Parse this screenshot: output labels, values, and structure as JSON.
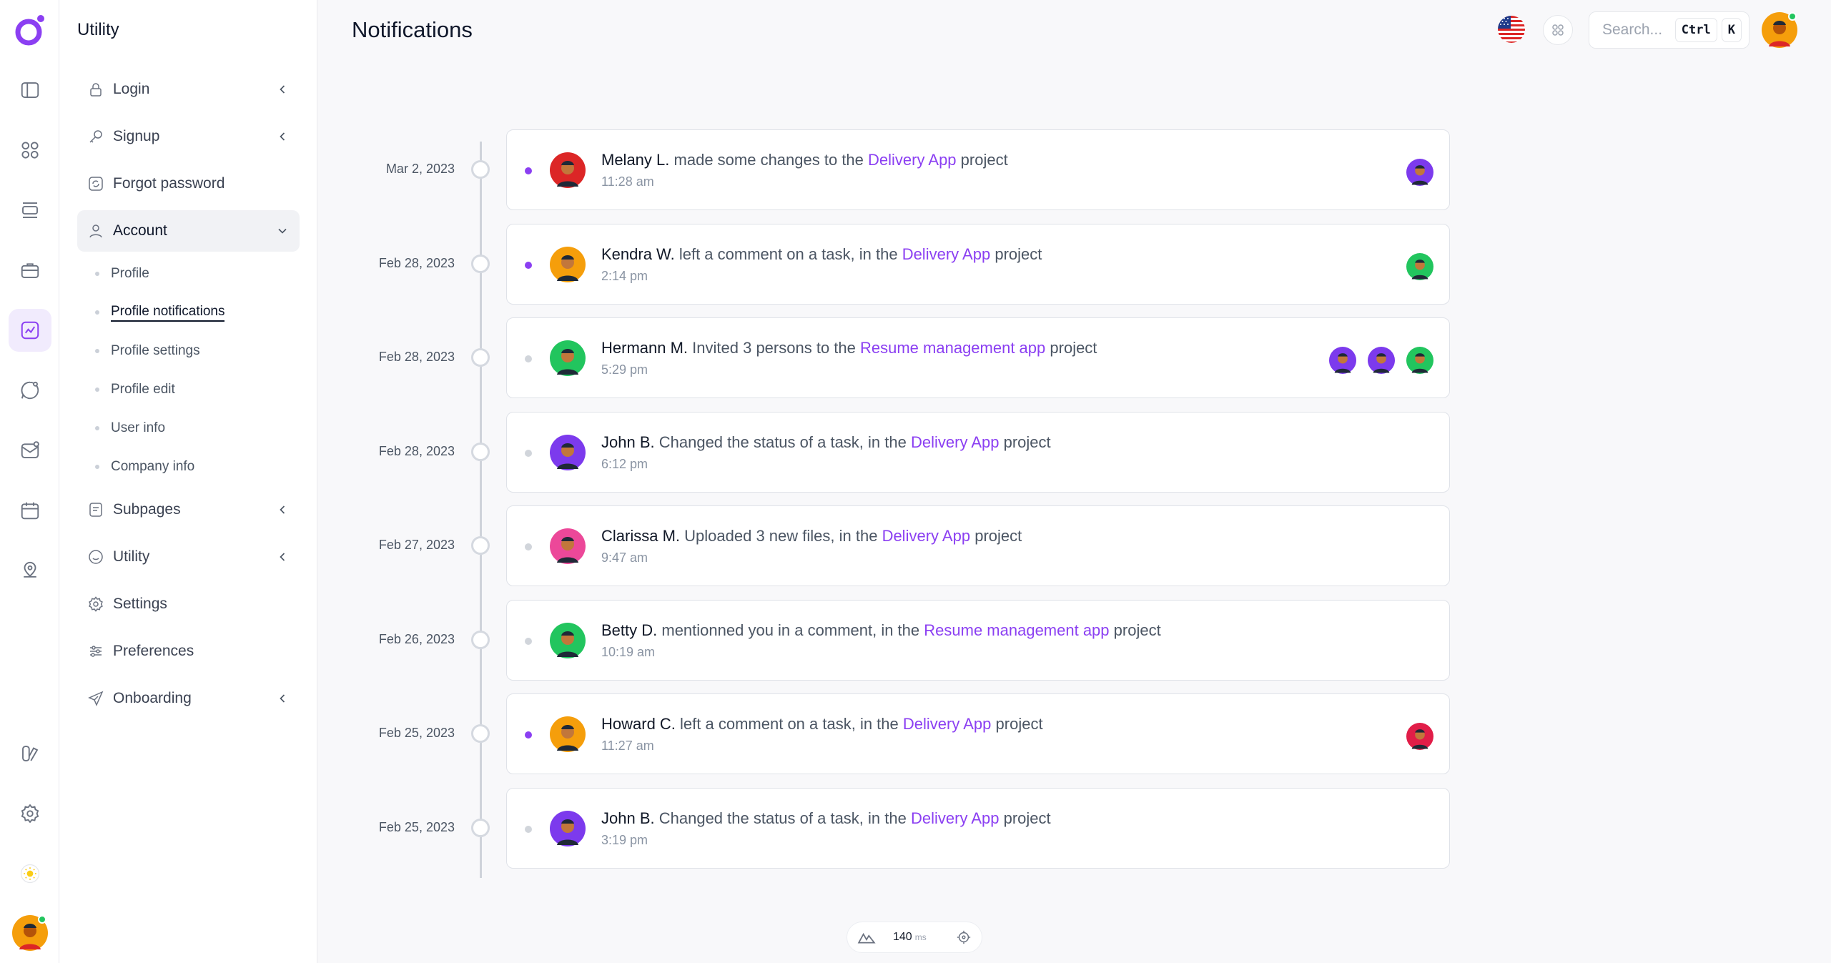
{
  "menu": {
    "title": "Utility",
    "items": [
      {
        "label": "Login"
      },
      {
        "label": "Signup"
      },
      {
        "label": "Forgot password"
      },
      {
        "label": "Account"
      },
      {
        "label": "Subpages"
      },
      {
        "label": "Utility"
      },
      {
        "label": "Settings"
      },
      {
        "label": "Preferences"
      },
      {
        "label": "Onboarding"
      }
    ],
    "account_sub": [
      {
        "label": "Profile"
      },
      {
        "label": "Profile notifications"
      },
      {
        "label": "Profile settings"
      },
      {
        "label": "Profile edit"
      },
      {
        "label": "User info"
      },
      {
        "label": "Company info"
      }
    ]
  },
  "header": {
    "title": "Notifications",
    "search_placeholder": "Search...",
    "kbd_ctrl": "Ctrl",
    "kbd_k": "K"
  },
  "colors": {
    "accent": "#8b3ff2",
    "unread": "#8b3ff2",
    "read": "#d1d5db"
  },
  "notifications": [
    {
      "date": "Mar 2, 2023",
      "name": "Melany L.",
      "text": "made some changes to the",
      "link": "Delivery App",
      "suffix": "project",
      "time": "11:28 am",
      "unread": true
    },
    {
      "date": "Feb 28, 2023",
      "name": "Kendra W.",
      "text": "left a comment on a task, in the",
      "link": "Delivery App",
      "suffix": "project",
      "time": "2:14 pm",
      "unread": true
    },
    {
      "date": "Feb 28, 2023",
      "name": "Hermann M.",
      "text": "Invited 3 persons to the",
      "link": "Resume management app",
      "suffix": "project",
      "time": "5:29 pm",
      "unread": false
    },
    {
      "date": "Feb 28, 2023",
      "name": "John B.",
      "text": "Changed the status of a task, in the",
      "link": "Delivery App",
      "suffix": "project",
      "time": "6:12 pm",
      "unread": false
    },
    {
      "date": "Feb 27, 2023",
      "name": "Clarissa M.",
      "text": "Uploaded 3 new files, in the",
      "link": "Delivery App",
      "suffix": "project",
      "time": "9:47 am",
      "unread": false
    },
    {
      "date": "Feb 26, 2023",
      "name": "Betty D.",
      "text": "mentionned you in a comment, in the",
      "link": "Resume management app",
      "suffix": "project",
      "time": "10:19 am",
      "unread": false
    },
    {
      "date": "Feb 25, 2023",
      "name": "Howard C.",
      "text": "left a comment on a task, in the",
      "link": "Delivery App",
      "suffix": "project",
      "time": "11:27 am",
      "unread": true
    },
    {
      "date": "Feb 25, 2023",
      "name": "John B.",
      "text": "Changed the status of a task, in the",
      "link": "Delivery App",
      "suffix": "project",
      "time": "3:19 pm",
      "unread": false
    }
  ],
  "perf": {
    "value": "140",
    "unit": "ms"
  }
}
